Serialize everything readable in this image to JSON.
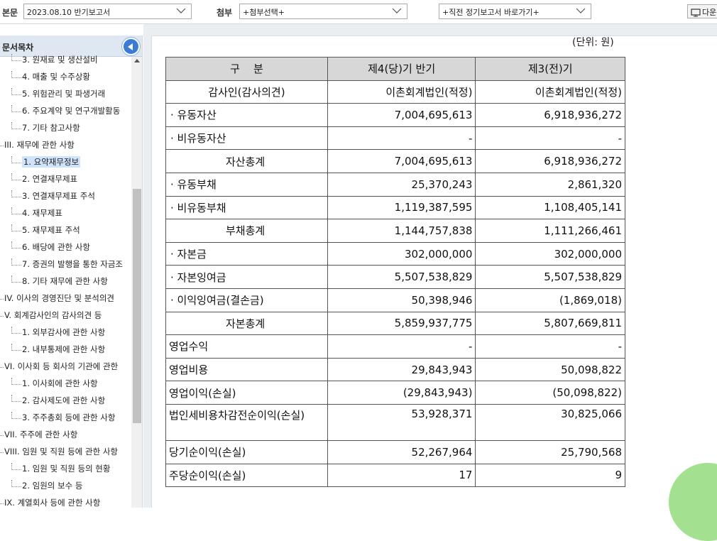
{
  "topbar": {
    "body_label": "본문",
    "report_select": "2023.08.10  반기보고서",
    "attach_label": "첨부",
    "attach_select": "+첨부선택+",
    "prev_report_select": "+직전 정기보고서 바로가기+",
    "next_label": "다운"
  },
  "sidebar": {
    "title": "문서목차",
    "items": [
      {
        "label": "3. 원재료 및 생산설비",
        "level": 2
      },
      {
        "label": "4. 매출 및 수주상황",
        "level": 2
      },
      {
        "label": "5. 위험관리 및 파생거래",
        "level": 2
      },
      {
        "label": "6. 주요계약 및 연구개발활동",
        "level": 2
      },
      {
        "label": "7. 기타 참고사항",
        "level": 2
      },
      {
        "label": "III. 재무에 관한 사항",
        "level": 1
      },
      {
        "label": "1. 요약재무정보",
        "level": 2,
        "selected": true
      },
      {
        "label": "2. 연결재무제표",
        "level": 2
      },
      {
        "label": "3. 연결재무제표 주석",
        "level": 2
      },
      {
        "label": "4. 재무제표",
        "level": 2
      },
      {
        "label": "5. 재무제표 주석",
        "level": 2
      },
      {
        "label": "6. 배당에 관한 사항",
        "level": 2
      },
      {
        "label": "7. 증권의 발행을 통한 자금조",
        "level": 2
      },
      {
        "label": "8. 기타 재무에 관한 사항",
        "level": 2
      },
      {
        "label": "IV. 이사의 경영진단 및 분석의견",
        "level": 1
      },
      {
        "label": "V. 회계감사인의 감사의견 등",
        "level": 1
      },
      {
        "label": "1. 외부감사에 관한 사항",
        "level": 2
      },
      {
        "label": "2. 내부통제에 관한 사항",
        "level": 2
      },
      {
        "label": "VI. 이사회 등 회사의 기관에 관한",
        "level": 1
      },
      {
        "label": "1. 이사회에 관한 사항",
        "level": 2
      },
      {
        "label": "2. 감사제도에 관한 사항",
        "level": 2
      },
      {
        "label": "3. 주주총회 등에 관한 사항",
        "level": 2
      },
      {
        "label": "VII. 주주에 관한 사항",
        "level": 1
      },
      {
        "label": "VIII. 임원 및 직원 등에 관한 사항",
        "level": 1
      },
      {
        "label": "1. 임원 및 직원 등의 현황",
        "level": 2
      },
      {
        "label": "2. 임원의 보수 등",
        "level": 2
      },
      {
        "label": "IX. 계열회사 등에 관한 사항",
        "level": 1
      }
    ]
  },
  "main": {
    "unit": "(단위: 원)",
    "table": {
      "headers": [
        "구    분",
        "제4(당)기 반기",
        "제3(전)기"
      ],
      "rows": [
        {
          "label": "감사인(감사의견)",
          "style": "center",
          "v1": "이촌회계법인(적정)",
          "v2": "이촌회계법인(적정)",
          "align": "right"
        },
        {
          "label": "유동자산",
          "style": "dot",
          "v1": "7,004,695,613",
          "v2": "6,918,936,272"
        },
        {
          "label": "비유동자산",
          "style": "dot",
          "v1": "-",
          "v2": "-"
        },
        {
          "label": "자산총계",
          "style": "indent",
          "v1": "7,004,695,613",
          "v2": "6,918,936,272"
        },
        {
          "label": "유동부채",
          "style": "dot",
          "v1": "25,370,243",
          "v2": "2,861,320"
        },
        {
          "label": "비유동부채",
          "style": "dot",
          "v1": "1,119,387,595",
          "v2": "1,108,405,141"
        },
        {
          "label": "부채총계",
          "style": "indent",
          "v1": "1,144,757,838",
          "v2": "1,111,266,461"
        },
        {
          "label": "자본금",
          "style": "dot",
          "v1": "302,000,000",
          "v2": "302,000,000"
        },
        {
          "label": "자본잉여금",
          "style": "dot",
          "v1": "5,507,538,829",
          "v2": "5,507,538,829"
        },
        {
          "label": "이익잉여금(결손금)",
          "style": "dot",
          "v1": "50,398,946",
          "v2": "(1,869,018)"
        },
        {
          "label": "자본총계",
          "style": "indent",
          "v1": "5,859,937,775",
          "v2": "5,807,669,811"
        },
        {
          "label": "영업수익",
          "style": "plain",
          "v1": "-",
          "v2": "-"
        },
        {
          "label": "영업비용",
          "style": "plain",
          "v1": "29,843,943",
          "v2": "50,098,822"
        },
        {
          "label": "영업이익(손실)",
          "style": "plain",
          "v1": "(29,843,943)",
          "v2": "(50,098,822)"
        },
        {
          "label": "법인세비용차감전순이익(손실)",
          "style": "plain",
          "v1": "53,928,371",
          "v2": "30,825,066",
          "tall": true
        },
        {
          "label": "당기순이익(손실)",
          "style": "plain",
          "v1": "52,267,964",
          "v2": "25,790,568"
        },
        {
          "label": "주당순이익(손실)",
          "style": "plain",
          "v1": "17",
          "v2": "9"
        }
      ]
    }
  }
}
